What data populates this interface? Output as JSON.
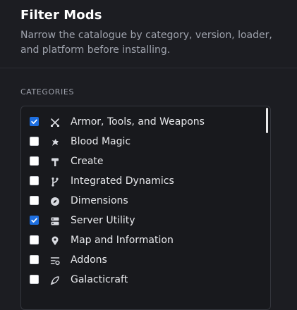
{
  "panel": {
    "title": "Filter Mods",
    "subtitle": "Narrow the catalogue by category, version, loader, and platform before installing."
  },
  "categories": {
    "heading": "CATEGORIES",
    "items": [
      {
        "label": "Armor, Tools, and Weapons",
        "checked": true,
        "icon": "crossed-swords-icon"
      },
      {
        "label": "Blood Magic",
        "checked": false,
        "icon": "magic-burst-icon"
      },
      {
        "label": "Create",
        "checked": false,
        "icon": "hammer-icon"
      },
      {
        "label": "Integrated Dynamics",
        "checked": false,
        "icon": "branch-icon"
      },
      {
        "label": "Dimensions",
        "checked": false,
        "icon": "compass-icon"
      },
      {
        "label": "Server Utility",
        "checked": true,
        "icon": "server-icon"
      },
      {
        "label": "Map and Information",
        "checked": false,
        "icon": "map-pin-icon"
      },
      {
        "label": "Addons",
        "checked": false,
        "icon": "list-settings-icon"
      },
      {
        "label": "Galacticraft",
        "checked": false,
        "icon": "rocket-icon"
      }
    ]
  },
  "colors": {
    "accent": "#1e6fe0",
    "background": "#1c1d22"
  }
}
